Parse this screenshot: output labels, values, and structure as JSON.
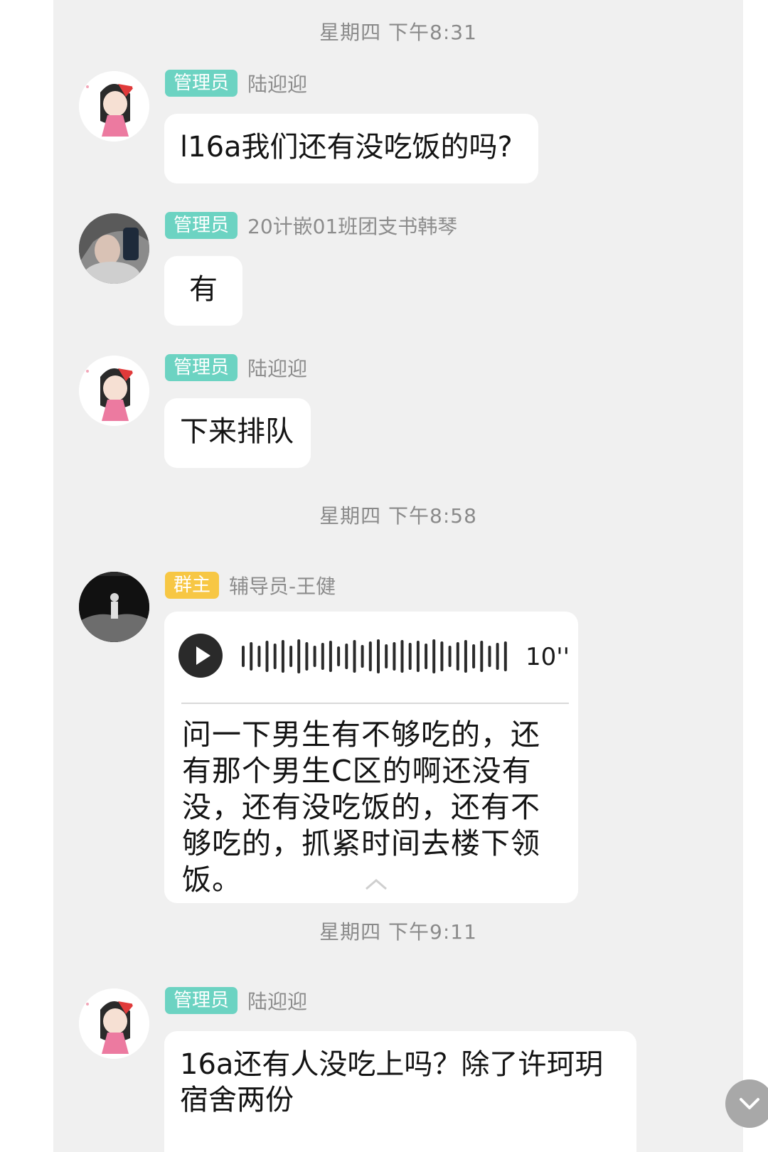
{
  "messages_group1": {
    "timestamp": "星期四 下午8:31",
    "msg1": {
      "badge": "管理员",
      "sender": "陆迎迎",
      "text": "l16a我们还有没吃饭的吗?"
    },
    "msg2": {
      "badge": "管理员",
      "sender": "20计嵌01班团支书韩琴",
      "text": "有"
    },
    "msg3": {
      "badge": "管理员",
      "sender": "陆迎迎",
      "text": "下来排队"
    }
  },
  "messages_group2": {
    "timestamp": "星期四 下午8:58",
    "msg1": {
      "badge": "群主",
      "sender": "辅导员-王健",
      "voice_duration": "10''",
      "transcript": "问一下男生有不够吃的，还有那个男生C区的啊还没有没，还有没吃饭的，还有不够吃的，抓紧时间去楼下领饭。"
    }
  },
  "messages_group3": {
    "timestamp": "星期四 下午9:11",
    "msg1": {
      "badge": "管理员",
      "sender": "陆迎迎",
      "text": "16a还有人没吃上吗？除了许珂玥宿舍两份"
    }
  },
  "colors": {
    "chat_background": "#f0f0f0",
    "admin_badge": "#6cd3c2",
    "owner_badge": "#f7c744",
    "bubble": "#ffffff"
  },
  "icons": [
    "play-icon",
    "voice-waveform-icon",
    "collapse-chevron-icon",
    "scroll-down-chevron-icon"
  ]
}
